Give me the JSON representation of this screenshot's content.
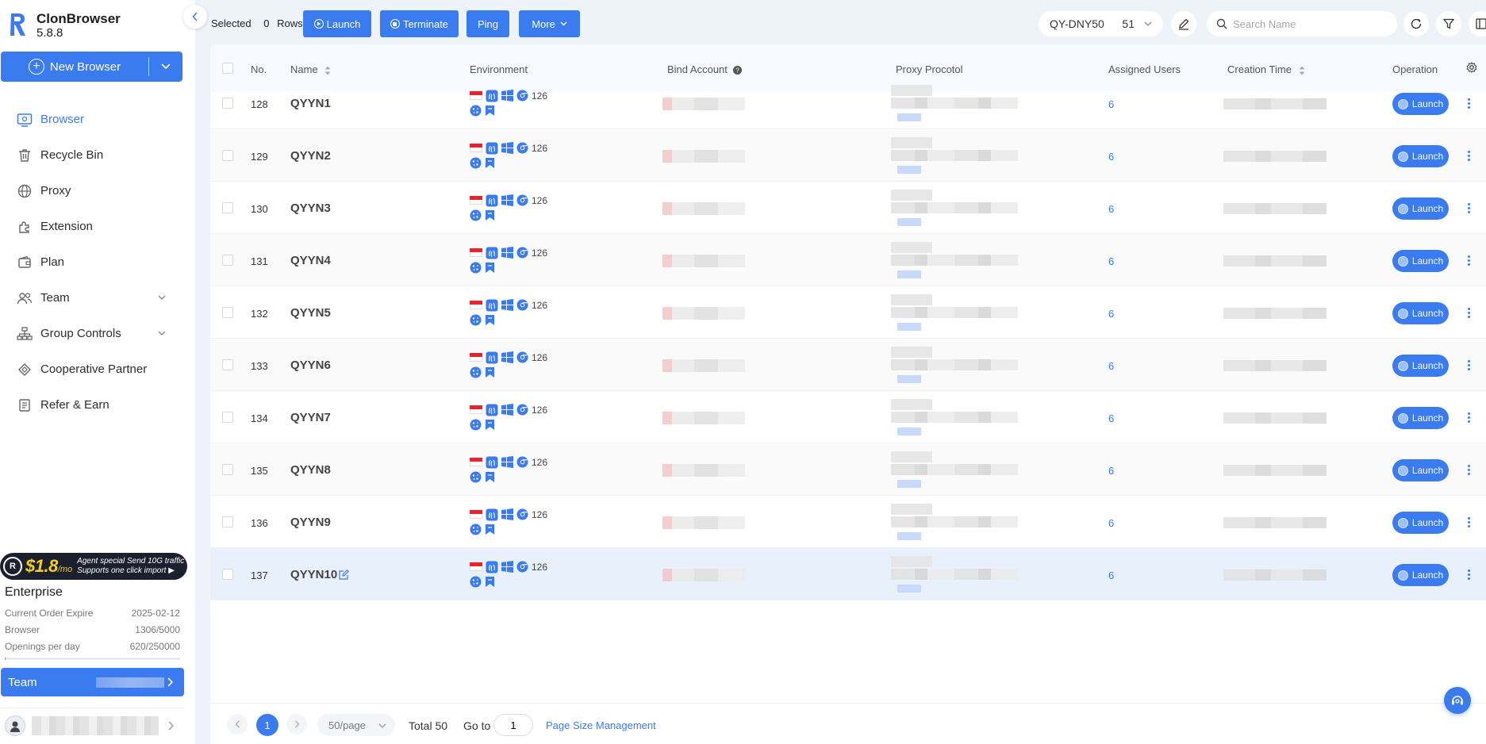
{
  "app": {
    "name": "ClonBrowser",
    "version": "5.8.8",
    "accent": "#3a7bf0"
  },
  "sidebar": {
    "new_browser_label": "New Browser",
    "items": [
      {
        "label": "Browser",
        "icon": "browser-icon",
        "active": true
      },
      {
        "label": "Recycle Bin",
        "icon": "trash-icon"
      },
      {
        "label": "Proxy",
        "icon": "globe-icon"
      },
      {
        "label": "Extension",
        "icon": "puzzle-icon"
      },
      {
        "label": "Plan",
        "icon": "wallet-icon"
      },
      {
        "label": "Team",
        "icon": "team-icon",
        "expandable": true
      },
      {
        "label": "Group Controls",
        "icon": "group-controls-icon",
        "expandable": true
      },
      {
        "label": "Cooperative Partner",
        "icon": "partner-icon"
      },
      {
        "label": "Refer & Earn",
        "icon": "refer-icon"
      }
    ],
    "promo": {
      "price": "$1.8",
      "unit": "/mo",
      "line1": "Agent special Send 10G traffic",
      "line2": "Supports one click import ▶"
    },
    "plan": {
      "title": "Enterprise",
      "rows": [
        {
          "label": "Current Order Expire",
          "value": "2025-02-12"
        },
        {
          "label": "Browser",
          "value": "1306/5000"
        },
        {
          "label": "Openings per day",
          "value": "620/250000"
        }
      ],
      "openings_fraction": 0.0025
    },
    "team_button_label": "Team"
  },
  "toolbar": {
    "selected_label": "Selected",
    "selected_count": "0",
    "rows_label": "Rows",
    "launch_label": "Launch",
    "terminate_label": "Terminate",
    "ping_label": "Ping",
    "more_label": "More",
    "group_name": "QY-DNY50",
    "group_count": "51",
    "search_placeholder": "Search Name"
  },
  "table": {
    "columns": {
      "no": "No.",
      "name": "Name",
      "environment": "Environment",
      "bind_account": "Bind Account",
      "proxy_protocol": "Proxy Procotol",
      "assigned_users": "Assigned Users",
      "creation_time": "Creation Time",
      "operation": "Operation"
    },
    "launch_label": "Launch",
    "rows": [
      {
        "no": "128",
        "name": "QYYN1",
        "env_version": "126",
        "users": "6"
      },
      {
        "no": "129",
        "name": "QYYN2",
        "env_version": "126",
        "users": "6"
      },
      {
        "no": "130",
        "name": "QYYN3",
        "env_version": "126",
        "users": "6"
      },
      {
        "no": "131",
        "name": "QYYN4",
        "env_version": "126",
        "users": "6"
      },
      {
        "no": "132",
        "name": "QYYN5",
        "env_version": "126",
        "users": "6"
      },
      {
        "no": "133",
        "name": "QYYN6",
        "env_version": "126",
        "users": "6"
      },
      {
        "no": "134",
        "name": "QYYN7",
        "env_version": "126",
        "users": "6"
      },
      {
        "no": "135",
        "name": "QYYN8",
        "env_version": "126",
        "users": "6"
      },
      {
        "no": "136",
        "name": "QYYN9",
        "env_version": "126",
        "users": "6"
      },
      {
        "no": "137",
        "name": "QYYN10",
        "env_version": "126",
        "users": "6",
        "highlighted": true
      }
    ]
  },
  "pagination": {
    "current_page": "1",
    "page_size": "50/page",
    "total": "Total 50",
    "goto_label": "Go to",
    "goto_value": "1",
    "page_size_link": "Page Size Management"
  }
}
